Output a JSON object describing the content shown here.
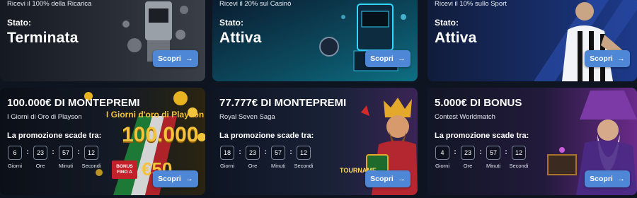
{
  "top_cards": [
    {
      "subtitle": "Ricevi il 100% della Ricarica",
      "state_label": "Stato:",
      "state": "Terminata",
      "button": "Scopri"
    },
    {
      "subtitle": "Ricevi il 20% sul Casinò",
      "state_label": "Stato:",
      "state": "Attiva",
      "button": "Scopri"
    },
    {
      "subtitle": "Ricevi il 10% sullo Sport",
      "state_label": "Stato:",
      "state": "Attiva",
      "button": "Scopri"
    }
  ],
  "promos": [
    {
      "title": "100.000€ DI MONTEPREMI",
      "subtitle": "I Giorni di Oro di Playson",
      "expires_label": "La promozione scade tra:",
      "timer": {
        "days": "6",
        "hours": "23",
        "minutes": "57",
        "seconds": "12"
      },
      "button": "Scopri",
      "art": {
        "banner": "I Giorni d'oro di Playson",
        "amount": "100.000",
        "badge_line1": "BONUS",
        "badge_line2": "FINO A",
        "bonus_amount": "€50"
      }
    },
    {
      "title": "77.777€ DI MONTEPREMI",
      "subtitle": "Royal Seven Saga",
      "expires_label": "La promozione scade tra:",
      "timer": {
        "days": "18",
        "hours": "23",
        "minutes": "57",
        "seconds": "12"
      },
      "button": "Scopri",
      "art": {
        "badge": "TOURNAME"
      }
    },
    {
      "title": "5.000€ DI BONUS",
      "subtitle": "Contest Worldmatch",
      "expires_label": "La promozione scade tra:",
      "timer": {
        "days": "4",
        "hours": "23",
        "minutes": "57",
        "seconds": "12"
      },
      "button": "Scopri"
    }
  ],
  "timer_labels": {
    "days": "Giorni",
    "hours": "Ore",
    "minutes": "Minuti",
    "seconds": "Secondi"
  },
  "icons": {
    "button_arrow": "arrow-right-icon"
  },
  "colors": {
    "page_bg": "#0e1420",
    "button": "#4d87d6",
    "timer_border": "#7c879a"
  }
}
